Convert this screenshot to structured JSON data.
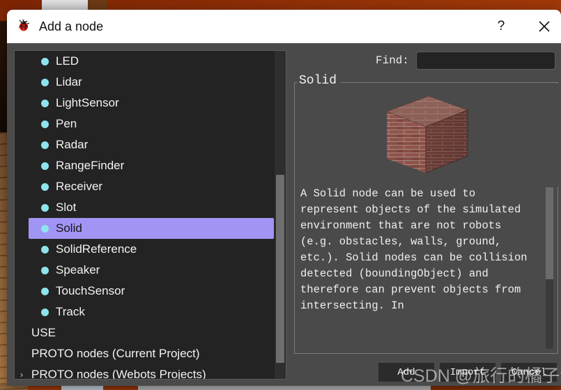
{
  "window": {
    "title": "Add a node",
    "icon": "ladybug-icon",
    "help_label": "?",
    "close_label": "✕"
  },
  "tree": {
    "nodes": [
      {
        "label": "LED",
        "type": "node",
        "selected": false
      },
      {
        "label": "Lidar",
        "type": "node",
        "selected": false
      },
      {
        "label": "LightSensor",
        "type": "node",
        "selected": false
      },
      {
        "label": "Pen",
        "type": "node",
        "selected": false
      },
      {
        "label": "Radar",
        "type": "node",
        "selected": false
      },
      {
        "label": "RangeFinder",
        "type": "node",
        "selected": false
      },
      {
        "label": "Receiver",
        "type": "node",
        "selected": false
      },
      {
        "label": "Slot",
        "type": "node",
        "selected": false
      },
      {
        "label": "Solid",
        "type": "node",
        "selected": true
      },
      {
        "label": "SolidReference",
        "type": "node",
        "selected": false
      },
      {
        "label": "Speaker",
        "type": "node",
        "selected": false
      },
      {
        "label": "TouchSensor",
        "type": "node",
        "selected": false
      },
      {
        "label": "Track",
        "type": "node",
        "selected": false
      }
    ],
    "categories": [
      {
        "label": "USE",
        "expandable": false
      },
      {
        "label": "PROTO nodes (Current Project)",
        "expandable": false
      },
      {
        "label": "PROTO nodes (Webots Projects)",
        "expandable": true
      }
    ],
    "bullet_color": "#8fe3ec",
    "selection_color": "#a095f5"
  },
  "find": {
    "label": "Find:",
    "value": "",
    "placeholder": ""
  },
  "details": {
    "group_title": "Solid",
    "preview_alt": "brick-cube-preview",
    "description": "A Solid node can be used to represent objects of the simulated environment that are not robots (e.g. obstacles, walls, ground, etc.). Solid nodes can be collision detected (boundingObject) and therefore can prevent objects from intersecting. In"
  },
  "buttons": {
    "add": "Add",
    "import": "Import",
    "cancel": "Cancel"
  },
  "watermark": {
    "text": "CSDN @旅行的橘子汽水"
  }
}
